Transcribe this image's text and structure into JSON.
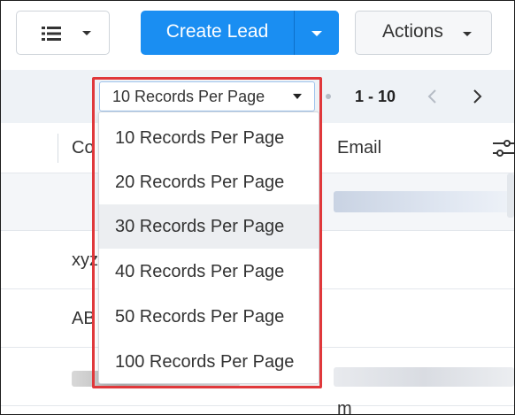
{
  "toolbar": {
    "view_icon": "list-view-icon",
    "create_label": "Create Lead",
    "actions_label": "Actions"
  },
  "pager": {
    "per_page_label": "10 Records Per Page",
    "range": "1 - 10",
    "prev_icon": "chevron-left-icon",
    "next_icon": "chevron-right-icon"
  },
  "table": {
    "columns": [
      "Co",
      "Email"
    ],
    "rows": [
      {
        "company": "",
        "email": ""
      },
      {
        "company": "xyz",
        "email": ""
      },
      {
        "company": "AB",
        "email": ""
      },
      {
        "company": "",
        "email": "m"
      }
    ]
  },
  "dropdown": {
    "options": [
      "10 Records Per Page",
      "20 Records Per Page",
      "30 Records Per Page",
      "40 Records Per Page",
      "50 Records Per Page",
      "100 Records Per Page"
    ],
    "hovered_index": 2
  },
  "colors": {
    "primary": "#1a8ef2",
    "highlight": "#e0383b",
    "pager_bg": "#eef2f6"
  }
}
